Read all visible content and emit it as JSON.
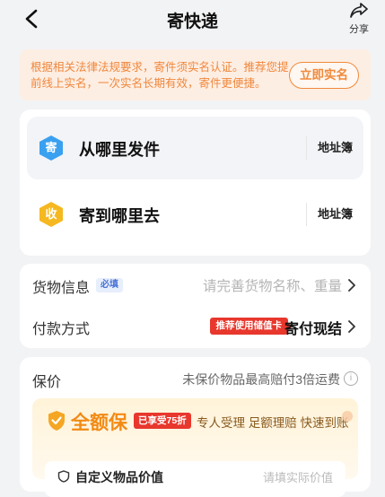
{
  "header": {
    "title": "寄快递",
    "share_label": "分享"
  },
  "notice": {
    "text": "根据相关法律法规要求，寄件须实名认证。推荐您提前线上实名，一次实名长期有效，寄件更便捷。",
    "button_label": "立即实名"
  },
  "address": {
    "sender": {
      "badge": "寄",
      "label": "从哪里发件",
      "book": "地址簿",
      "badge_color": "#3aa0f0"
    },
    "receiver": {
      "badge": "收",
      "label": "寄到哪里去",
      "book": "地址簿",
      "badge_color": "#f5b820"
    }
  },
  "goods": {
    "label": "货物信息",
    "required": "必填",
    "placeholder": "请完善货物名称、重量"
  },
  "payment": {
    "label": "付款方式",
    "promo": "推荐使用储值卡",
    "value": "寄付现结"
  },
  "insurance": {
    "label": "保价",
    "desc": "未保价物品最高赔付3倍运费",
    "banner_title": "全额保",
    "discount": "已享受75折",
    "slogan": "专人受理 足额理赔 快速到账",
    "item_label": "自定义物品价值",
    "item_placeholder": "请填实际价值"
  },
  "colors": {
    "accent_orange": "#f08a3c",
    "promo_red": "#e8372d",
    "gold": "#f28a14"
  }
}
